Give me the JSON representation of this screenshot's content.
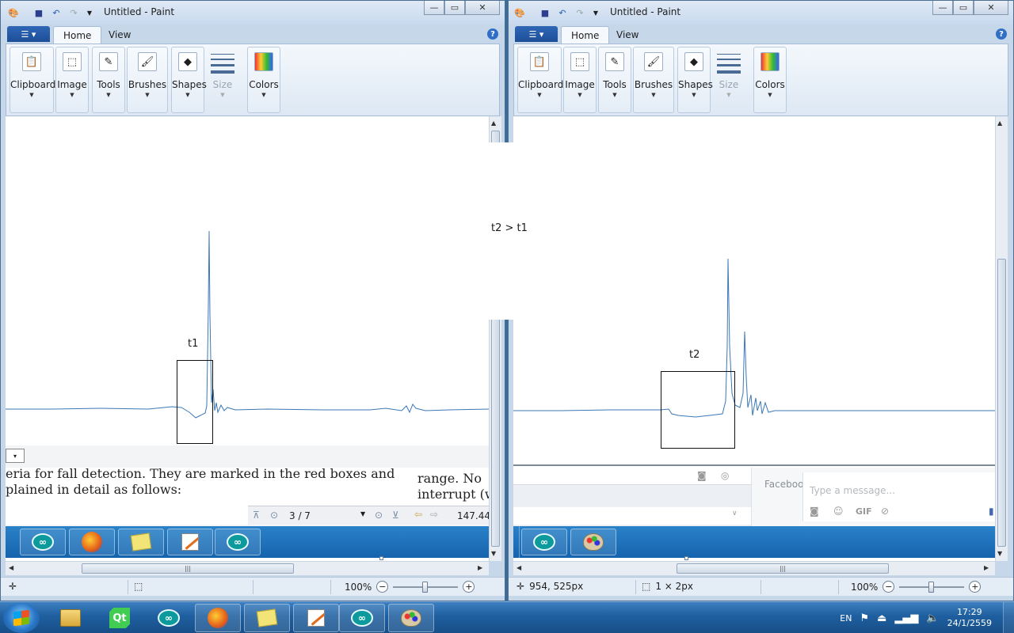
{
  "left_window": {
    "title": "Untitled - Paint",
    "tabs": {
      "home": "Home",
      "view": "View"
    },
    "groups": {
      "clipboard": "Clipboard",
      "image": "Image",
      "tools": "Tools",
      "brushes": "Brushes",
      "shapes": "Shapes",
      "size": "Size",
      "colors": "Colors"
    },
    "marker_label": "t1",
    "status": {
      "zoom": "100%"
    },
    "pasted_pdf": {
      "line1_left": "eria for fall detection. They are marked in the red boxes and",
      "line2_left": "plained in detail as follows:",
      "line1_right": "range. No",
      "line2_right": "interrupt (w",
      "page": "3 / 7",
      "zoom_value": "147.44"
    }
  },
  "right_window": {
    "title": "Untitled - Paint",
    "tabs": {
      "home": "Home",
      "view": "View"
    },
    "groups": {
      "clipboard": "Clipboard",
      "image": "Image",
      "tools": "Tools",
      "brushes": "Brushes",
      "shapes": "Shapes",
      "size": "Size",
      "colors": "Colors"
    },
    "marker_label": "t2",
    "status": {
      "cursor_pos": "954, 525px",
      "selection_size": "1 × 2px",
      "zoom": "100%"
    },
    "pasted_chat": {
      "facebook": "Faceboo",
      "placeholder": "Type a message...",
      "gif": "GIF"
    }
  },
  "comparison_label": "t2 > t1",
  "taskbar": {
    "language": "EN",
    "time": "17:29",
    "date": "24/1/2559"
  },
  "icons": [
    "paint-app-icon",
    "save-icon",
    "undo-icon",
    "redo-icon",
    "clipboard-icon",
    "image-select-icon",
    "tools-icon",
    "brush-icon",
    "shapes-icon",
    "size-icon",
    "colors-icon",
    "help-icon",
    "arduino-icon",
    "firefox-icon",
    "sticky-notes-icon",
    "grapher-icon",
    "explorer-icon",
    "qt-icon",
    "flag-icon",
    "network-icon",
    "volume-icon"
  ]
}
